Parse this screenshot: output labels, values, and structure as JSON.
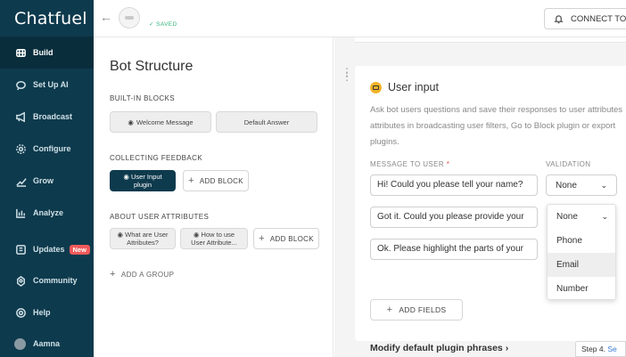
{
  "app": {
    "logo": "Chatfuel"
  },
  "sidebar": {
    "items": [
      {
        "label": "Build",
        "icon": "grid-icon",
        "active": true
      },
      {
        "label": "Set Up AI",
        "icon": "ai-icon"
      },
      {
        "label": "Broadcast",
        "icon": "megaphone-icon"
      },
      {
        "label": "Configure",
        "icon": "gear-icon"
      },
      {
        "label": "Grow",
        "icon": "trend-icon"
      },
      {
        "label": "Analyze",
        "icon": "bar-chart-icon"
      },
      {
        "label": "Updates",
        "icon": "updates-icon",
        "badge": "New"
      },
      {
        "label": "Community",
        "icon": "community-icon"
      },
      {
        "label": "Help",
        "icon": "help-icon"
      },
      {
        "label": "Aamna",
        "icon": "avatar"
      }
    ]
  },
  "topbar": {
    "saved": "SAVED",
    "connect_label": "CONNECT TO F"
  },
  "structure": {
    "title": "Bot Structure",
    "builtin_title": "BUILT-IN BLOCKS",
    "welcome_block": "Welcome Message",
    "default_block": "Default Answer",
    "feedback_title": "COLLECTING FEEDBACK",
    "user_input_block_line1": "User Input",
    "user_input_block_line2": "plugin",
    "add_block": "ADD BLOCK",
    "attributes_title": "ABOUT USER ATTRIBUTES",
    "what_are_line1": "What are User",
    "what_are_line2": "Attributes?",
    "how_to_line1": "How to use",
    "how_to_line2": "User Attribute...",
    "add_group": "ADD A GROUP"
  },
  "card": {
    "title": "User input",
    "description": "Ask bot users questions and save their responses to user attributes attributes in broadcasting user filters, Go to Block plugin or export plugins.",
    "message_label": "MESSAGE TO USER",
    "required_mark": "*",
    "validation_label": "VALIDATION",
    "messages": [
      "Hi! Could you please tell your name?",
      "Got it. Could you please provide your",
      "Ok. Please highlight the parts of your"
    ],
    "validation_value": "None",
    "add_fields": "ADD FIELDS",
    "modify_link": "Modify default plugin phrases"
  },
  "dropdown": {
    "selected": "None",
    "options": [
      "Phone",
      "Email",
      "Number"
    ],
    "hovered": "Email"
  },
  "tip": {
    "step": "Step 4.",
    "link": "Se"
  },
  "colors": {
    "sidebar": "#0e3a4d",
    "active": "#0a2d3c",
    "badge": "#f15a5a",
    "saved": "#36b37e",
    "accent": "#f0b429"
  }
}
